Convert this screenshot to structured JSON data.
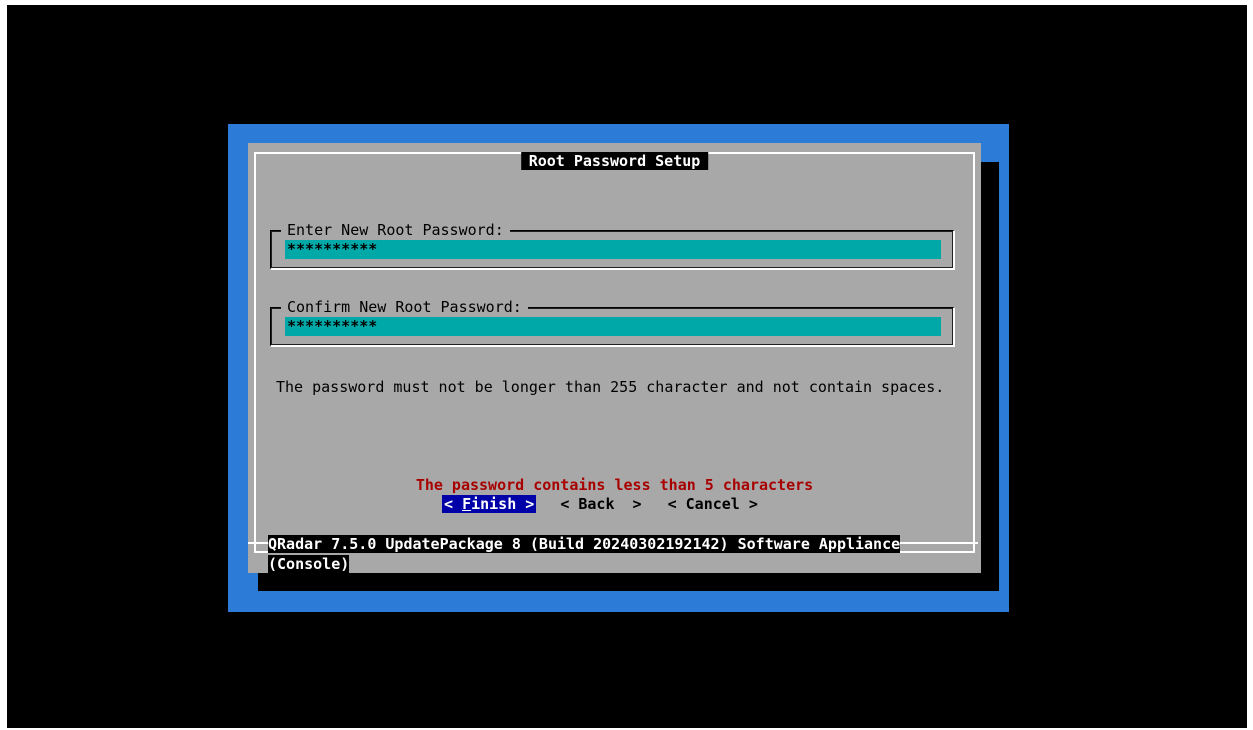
{
  "dialog": {
    "title": "Root Password Setup",
    "new_password_label": "Enter New Root Password:",
    "new_password_value": "**********",
    "confirm_password_label": "Confirm New Root Password:",
    "confirm_password_value": "**********",
    "help_text": "The password must not be longer than 255 character and not contain spaces.",
    "error_text": "The password contains less than 5 characters"
  },
  "buttons": {
    "finish_prefix": "< ",
    "finish_hotkey": "F",
    "finish_rest": "inish >",
    "back": "< Back  >",
    "cancel": "< Cancel >"
  },
  "footer": {
    "line1": "QRadar 7.5.0 UpdatePackage 8 (Build 20240302192142) Software Appliance",
    "line2": "(Console)"
  },
  "colors": {
    "screen_bg": "#000000",
    "blue_border": "#2c7bd6",
    "dialog_bg": "#a8a8a8",
    "input_bg": "#00a8a8",
    "error": "#a80000",
    "active_button_bg": "#0000a8"
  }
}
